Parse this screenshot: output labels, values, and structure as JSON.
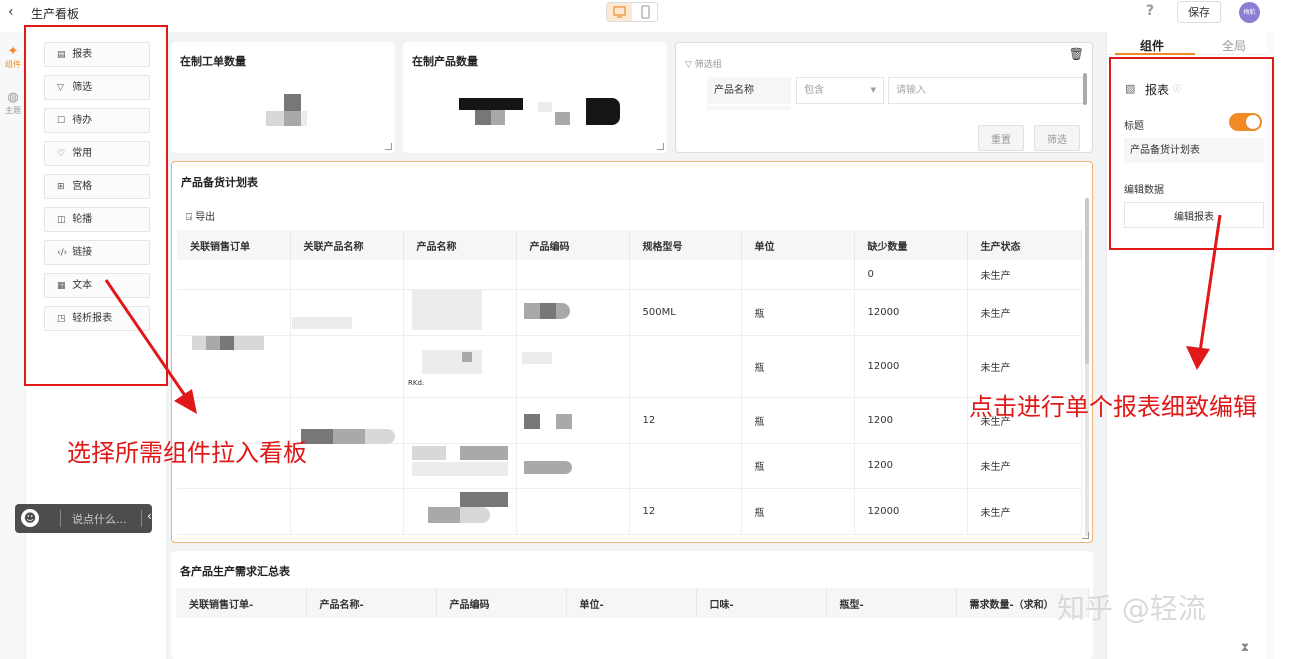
{
  "app": {
    "title": "生产看板",
    "save_label": "保存",
    "help": "?",
    "avatar_text": "梅航"
  },
  "rail": {
    "components_label": "组件",
    "theme_label": "主题"
  },
  "palette": {
    "items": [
      {
        "label": "报表",
        "icon": "report-icon"
      },
      {
        "label": "筛选",
        "icon": "filter-icon"
      },
      {
        "label": "待办",
        "icon": "todo-icon"
      },
      {
        "label": "常用",
        "icon": "heart-icon"
      },
      {
        "label": "宫格",
        "icon": "grid-icon"
      },
      {
        "label": "轮播",
        "icon": "carousel-icon"
      },
      {
        "label": "链接",
        "icon": "link-icon"
      },
      {
        "label": "文本",
        "icon": "text-icon"
      },
      {
        "label": "轻析报表",
        "icon": "analysis-report-icon"
      }
    ]
  },
  "chat": {
    "placeholder": "说点什么..."
  },
  "cards": {
    "wip_orders": {
      "title": "在制工单数量"
    },
    "wip_products": {
      "title": "在制产品数量"
    },
    "filter": {
      "group_label": "筛选组",
      "field_label": "产品名称",
      "operator": "包含",
      "input_placeholder": "请输入",
      "reset_label": "重置",
      "filter_label": "筛选"
    },
    "plan": {
      "title": "产品备货计划表",
      "export_label": "导出",
      "columns": [
        "关联销售订单",
        "关联产品名称",
        "产品名称",
        "产品编码",
        "规格型号",
        "单位",
        "缺少数量",
        "生产状态"
      ],
      "rows": [
        {
          "spec": "",
          "unit": "",
          "qty": "0",
          "status": "未生产"
        },
        {
          "spec": "500ML",
          "unit": "瓶",
          "qty": "12000",
          "status": "未生产"
        },
        {
          "spec": "",
          "unit": "瓶",
          "qty": "12000",
          "status": "未生产"
        },
        {
          "spec": "12",
          "unit": "瓶",
          "qty": "1200",
          "status": "未生产"
        },
        {
          "spec": "",
          "unit": "瓶",
          "qty": "1200",
          "status": "未生产"
        },
        {
          "spec": "12",
          "unit": "瓶",
          "qty": "12000",
          "status": "未生产"
        }
      ],
      "partial_text": "RKd."
    },
    "summary": {
      "title": "各产品生产需求汇总表",
      "columns": [
        "关联销售订单-",
        "产品名称-",
        "产品编码",
        "单位-",
        "口味-",
        "瓶型-",
        "需求数量-（求和）"
      ]
    }
  },
  "right_panel": {
    "tabs": [
      "组件",
      "全局"
    ],
    "component_name": "报表",
    "title_label": "标题",
    "title_toggle_on": true,
    "title_value": "产品备货计划表",
    "edit_data_label": "编辑数据",
    "edit_button_label": "编辑报表"
  },
  "annotations": {
    "left": "选择所需组件拉入看板",
    "right": "点击进行单个报表细致编辑",
    "color": "#e01818"
  },
  "watermark": "知乎 @轻流",
  "accent_color": "#f08a24"
}
